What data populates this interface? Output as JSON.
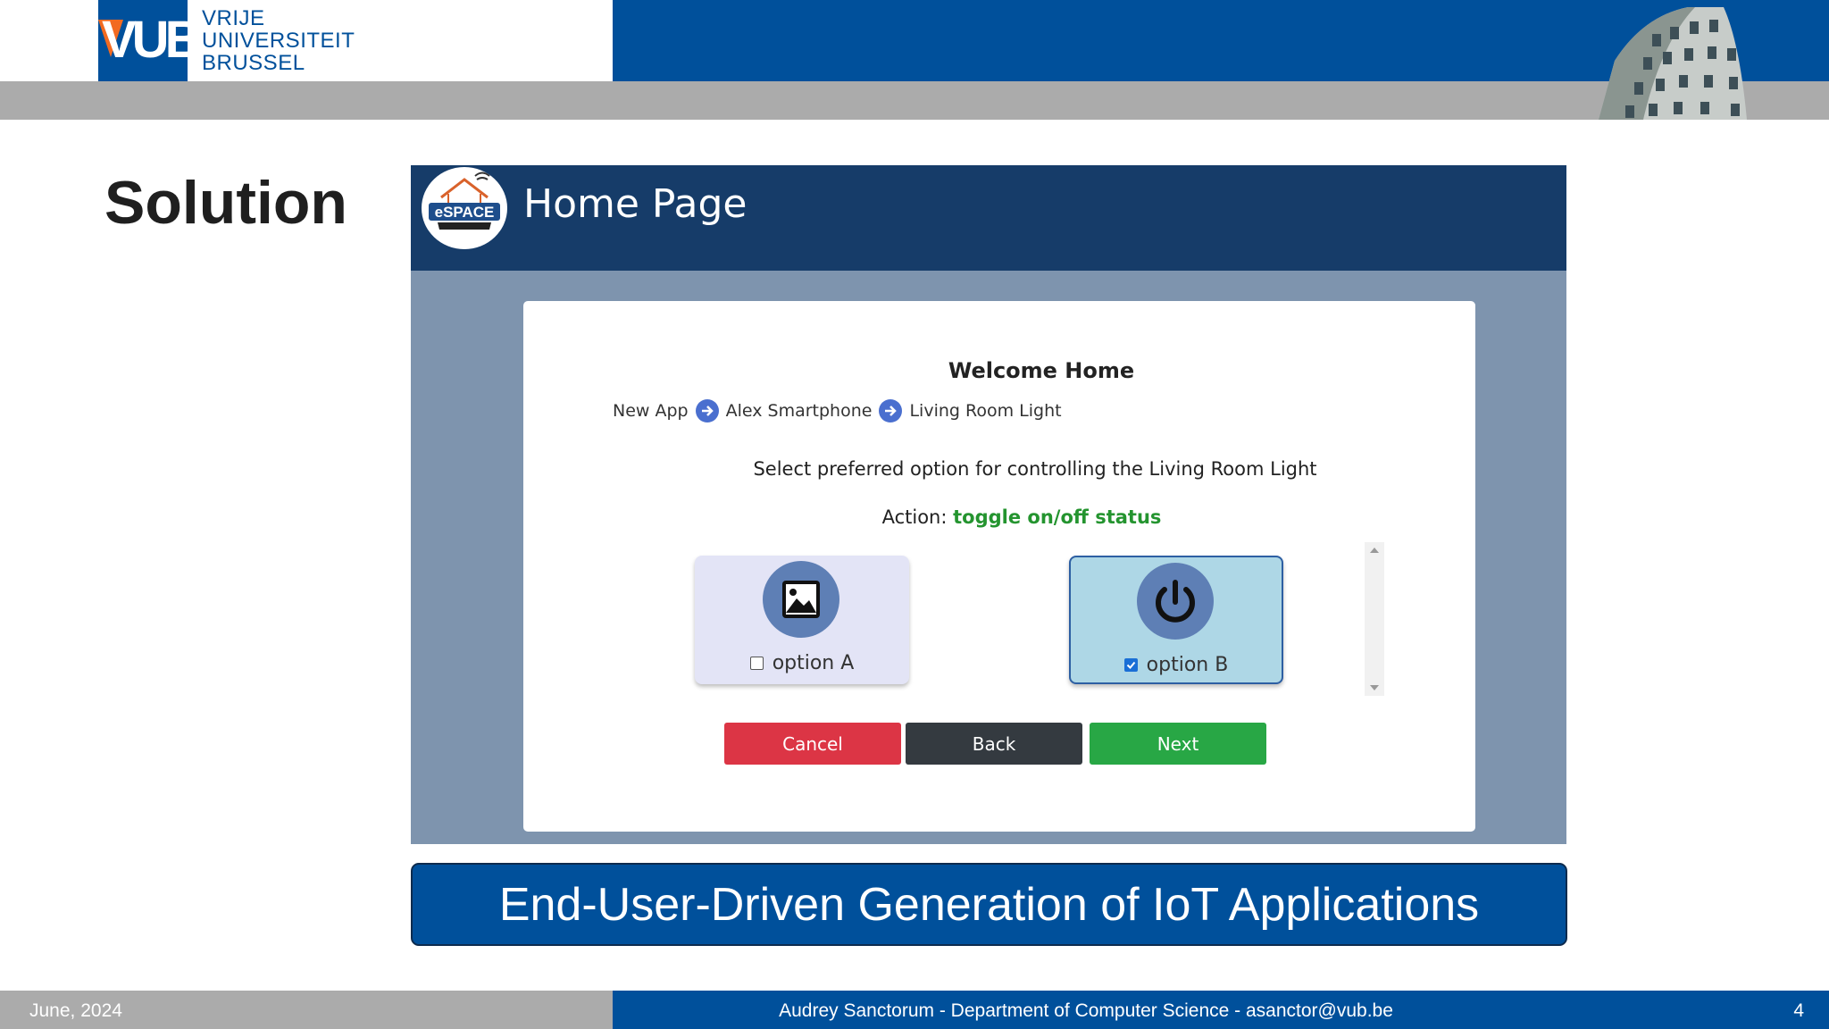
{
  "header": {
    "logo_text": "VUB",
    "university_lines": [
      "VRIJE",
      "UNIVERSITEIT",
      "BRUSSEL"
    ]
  },
  "slide": {
    "title": "Solution",
    "caption": "End-User-Driven Generation of IoT Applications"
  },
  "app": {
    "logo_text": "eSPACE",
    "title": "Home Page",
    "welcome": "Welcome Home",
    "breadcrumb": [
      "New App",
      "Alex Smartphone",
      "Living Room Light"
    ],
    "instruction": "Select preferred option for controlling the Living Room Light",
    "action_label": "Action:",
    "action_value": "toggle on/off status",
    "options": [
      {
        "label": "option A",
        "icon": "image-icon",
        "checked": false
      },
      {
        "label": "option B",
        "icon": "power-icon",
        "checked": true
      }
    ],
    "buttons": {
      "cancel": "Cancel",
      "back": "Back",
      "next": "Next"
    },
    "colors": {
      "cancel": "#dc3545",
      "back": "#343a40",
      "next": "#28a745",
      "action": "#24942f"
    }
  },
  "footer": {
    "date": "June, 2024",
    "author": "Audrey Sanctorum - Department of Computer Science - asanctor@vub.be",
    "page_number": "4"
  },
  "brand_colors": {
    "vub_blue": "#00509b",
    "vub_orange": "#f26a21",
    "gray_band": "#ababab"
  }
}
